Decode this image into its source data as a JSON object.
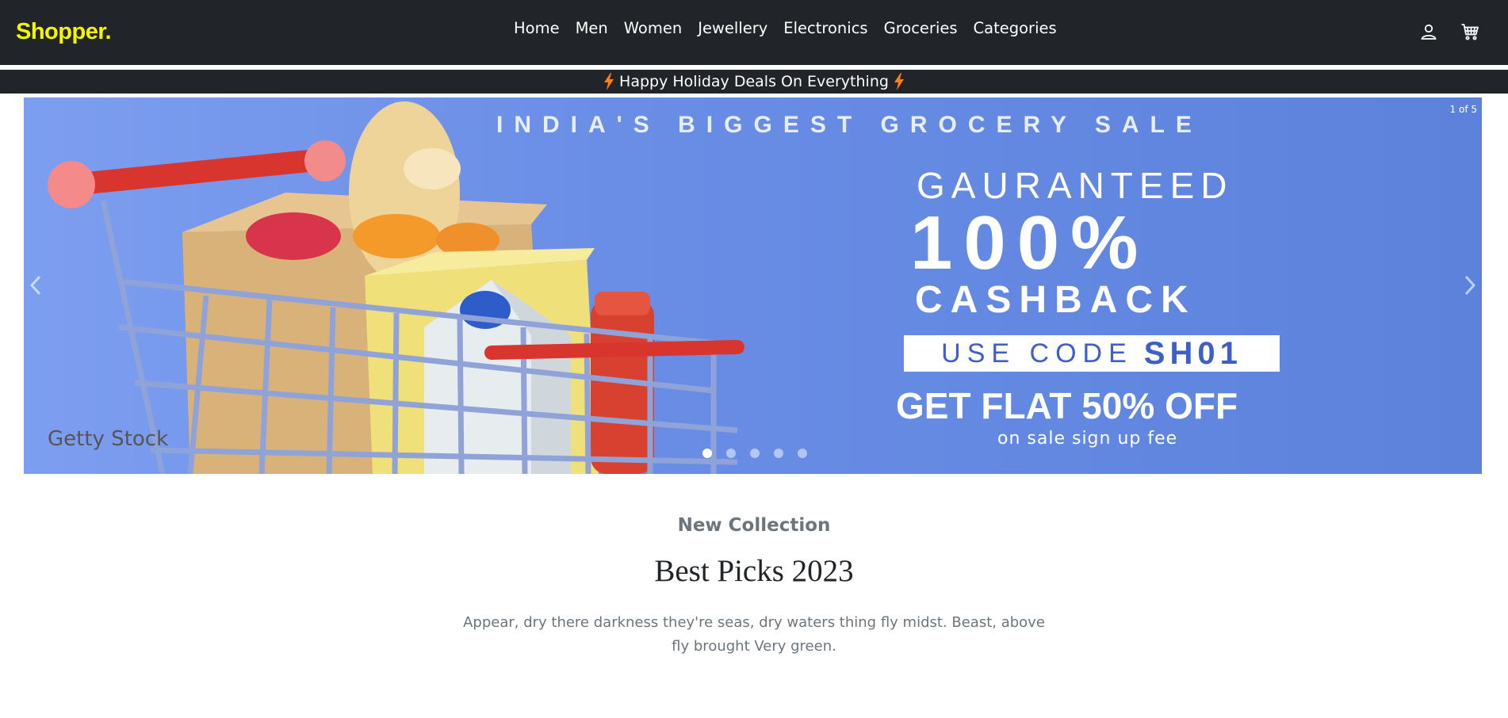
{
  "navbar": {
    "brand": "Shopper.",
    "links": [
      "Home",
      "Men",
      "Women",
      "Jewellery",
      "Electronics",
      "Groceries",
      "Categories"
    ],
    "icons": [
      "user-icon",
      "cart-icon"
    ]
  },
  "promo": {
    "text": "Happy Holiday Deals On Everything",
    "icon": "lightning-icon",
    "icon_color": "#fd7e14"
  },
  "carousel": {
    "counter": "1 of 5",
    "active_slide": 1,
    "total_slides": 5,
    "slide": {
      "headline": "INDIA'S BIGGEST GROCERY SALE",
      "guaranteed": "GAURANTEED",
      "percent": "100%",
      "cashback": "CASHBACK",
      "code_label": "USE CODE",
      "code_value": "SH01",
      "offer": "GET FLAT 50% OFF",
      "sub": "on sale sign up fee",
      "watermark": "Getty Stock"
    }
  },
  "section": {
    "kicker": "New Collection",
    "title": "Best Picks 2023",
    "description": "Appear, dry there darkness they're seas, dry waters thing fly midst. Beast, above fly brought Very green."
  },
  "colors": {
    "navbar_bg": "#212529",
    "brand": "#f5f500",
    "banner_bg": "#6a8ee6"
  }
}
